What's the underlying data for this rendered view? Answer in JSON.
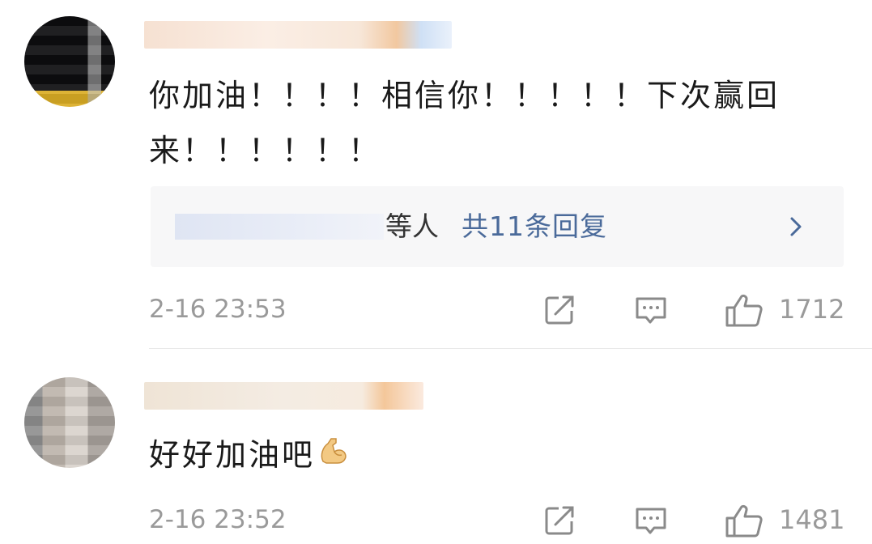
{
  "comments": [
    {
      "text": "你加油！！！！相信你！！！！！下次赢回来！！！！！！",
      "replies": {
        "suffix": "等人",
        "more_label": "共11条回复"
      },
      "time": "2-16 23:53",
      "likes": "1712"
    },
    {
      "text": "好好加油吧",
      "emoji": "flexed-biceps",
      "time": "2-16 23:52",
      "likes": "1481"
    }
  ],
  "icons": {
    "share": "share-icon",
    "comment": "comment-icon",
    "like": "thumbs-up-icon",
    "chevron": "chevron-right-icon"
  },
  "colors": {
    "link": "#4a6a9a",
    "meta": "#9a9a9a",
    "text": "#1a1a1a"
  }
}
